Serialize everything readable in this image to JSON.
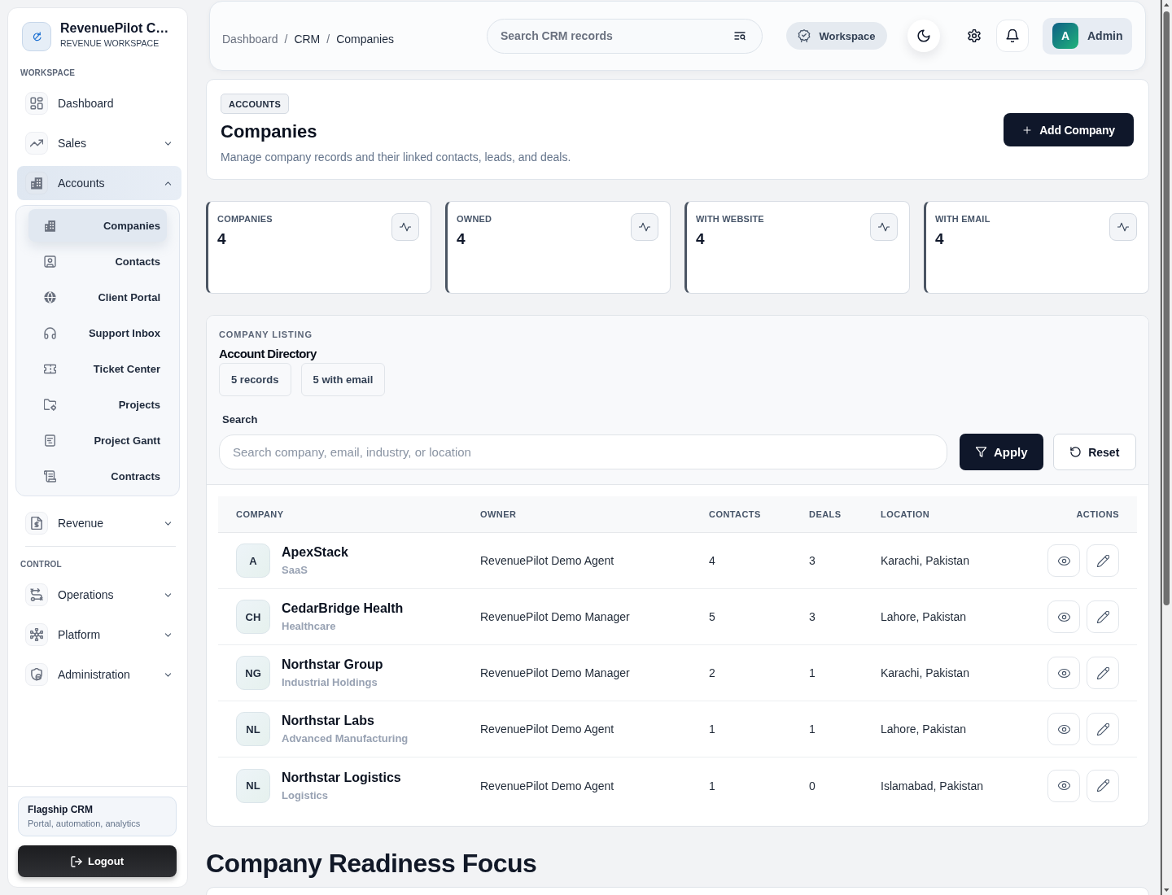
{
  "sidebar": {
    "brand": {
      "name": "RevenuePilot C…",
      "subtitle": "REVENUE WORKSPACE"
    },
    "sections": [
      {
        "title": "WORKSPACE",
        "items": [
          {
            "label": "Dashboard",
            "kind": "link",
            "selected": false
          },
          {
            "label": "Sales",
            "kind": "group",
            "selected": false,
            "expanded": false
          },
          {
            "label": "Accounts",
            "kind": "group",
            "selected": true,
            "expanded": true,
            "children": [
              {
                "label": "Companies",
                "selected": true
              },
              {
                "label": "Contacts",
                "selected": false
              },
              {
                "label": "Client Portal",
                "selected": false
              },
              {
                "label": "Support Inbox",
                "selected": false
              },
              {
                "label": "Ticket Center",
                "selected": false
              },
              {
                "label": "Projects",
                "selected": false
              },
              {
                "label": "Project Gantt",
                "selected": false
              },
              {
                "label": "Contracts",
                "selected": false
              }
            ]
          },
          {
            "label": "Revenue",
            "kind": "group",
            "selected": false,
            "expanded": false
          }
        ]
      },
      {
        "title": "CONTROL",
        "items": [
          {
            "label": "Operations",
            "kind": "group",
            "selected": false,
            "expanded": false
          },
          {
            "label": "Platform",
            "kind": "group",
            "selected": false,
            "expanded": false
          },
          {
            "label": "Administration",
            "kind": "group",
            "selected": false,
            "expanded": false
          }
        ]
      }
    ],
    "footer": {
      "title": "Flagship CRM",
      "subtitle": "Portal, automation, analytics",
      "logout": "Logout"
    }
  },
  "header": {
    "breadcrumb": [
      {
        "label": "Dashboard",
        "kind": "link"
      },
      {
        "label": "/",
        "kind": "separator"
      },
      {
        "label": "CRM",
        "kind": "text"
      },
      {
        "label": "/",
        "kind": "separator"
      },
      {
        "label": "Companies",
        "kind": "text"
      }
    ],
    "search": {
      "placeholder": "Search CRM records"
    },
    "workspace_button": "Workspace",
    "user": {
      "initial": "A",
      "name": "Admin"
    }
  },
  "page": {
    "badge": "ACCOUNTS",
    "title": "Companies",
    "description": "Manage company records and their linked contacts, leads, and deals.",
    "primary_action": "Add Company"
  },
  "stats": [
    {
      "label": "COMPANIES",
      "value": "4"
    },
    {
      "label": "OWNED",
      "value": "4"
    },
    {
      "label": "WITH WEBSITE",
      "value": "4"
    },
    {
      "label": "WITH EMAIL",
      "value": "4"
    }
  ],
  "listing": {
    "eyebrow": "COMPANY LISTING",
    "title": "Account Directory",
    "chips": [
      "5 records",
      "5 with email"
    ],
    "search": {
      "label": "Search",
      "placeholder": "Search company, email, industry, or location"
    },
    "apply": "Apply",
    "reset": "Reset",
    "table": {
      "columns": [
        "COMPANY",
        "OWNER",
        "CONTACTS",
        "DEALS",
        "LOCATION",
        "ACTIONS"
      ],
      "rows": [
        {
          "initials": "A",
          "name": "ApexStack",
          "industry": "SaaS",
          "owner": "RevenuePilot Demo Agent",
          "contacts": "4",
          "deals": "3",
          "location": "Karachi, Pakistan"
        },
        {
          "initials": "CH",
          "name": "CedarBridge Health",
          "industry": "Healthcare",
          "owner": "RevenuePilot Demo Manager",
          "contacts": "5",
          "deals": "3",
          "location": "Lahore, Pakistan"
        },
        {
          "initials": "NG",
          "name": "Northstar Group",
          "industry": "Industrial Holdings",
          "owner": "RevenuePilot Demo Manager",
          "contacts": "2",
          "deals": "1",
          "location": "Karachi, Pakistan"
        },
        {
          "initials": "NL",
          "name": "Northstar Labs",
          "industry": "Advanced Manufacturing",
          "owner": "RevenuePilot Demo Agent",
          "contacts": "1",
          "deals": "1",
          "location": "Lahore, Pakistan"
        },
        {
          "initials": "NL",
          "name": "Northstar Logistics",
          "industry": "Logistics",
          "owner": "RevenuePilot Demo Agent",
          "contacts": "1",
          "deals": "0",
          "location": "Islamabad, Pakistan"
        }
      ]
    }
  },
  "readiness": {
    "title": "Company Readiness Focus"
  }
}
